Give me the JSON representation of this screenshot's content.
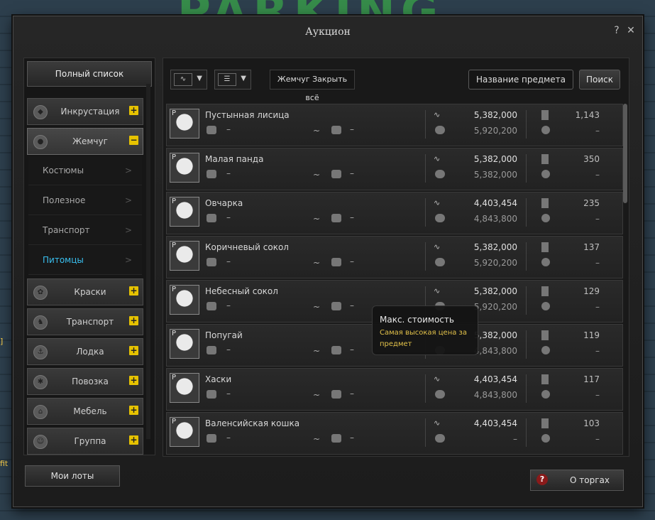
{
  "window": {
    "title": "Аукцион",
    "help": "?",
    "close": "✕"
  },
  "background": {
    "sign": "PARKING"
  },
  "side_texts": [
    "]",
    "fit"
  ],
  "sidebar": {
    "header": "Полный список",
    "categories": [
      {
        "label": "Инкрустация",
        "toggle": "+",
        "icon": "gem-icon"
      },
      {
        "label": "Жемчуг",
        "toggle": "−",
        "icon": "pearl-icon",
        "active": true
      },
      {
        "label": "Краски",
        "toggle": "+",
        "icon": "palette-icon"
      },
      {
        "label": "Транспорт",
        "toggle": "+",
        "icon": "horse-icon"
      },
      {
        "label": "Лодка",
        "toggle": "+",
        "icon": "anchor-icon"
      },
      {
        "label": "Повозка",
        "toggle": "+",
        "icon": "wheel-icon"
      },
      {
        "label": "Мебель",
        "toggle": "+",
        "icon": "house-icon"
      },
      {
        "label": "Группа",
        "toggle": "+",
        "icon": "group-icon"
      }
    ],
    "subitems": [
      {
        "label": "Костюмы",
        "chev": ">"
      },
      {
        "label": "Полезное",
        "chev": ">"
      },
      {
        "label": "Транспорт",
        "chev": ">"
      },
      {
        "label": "Питомцы",
        "chev": ">",
        "active": true
      }
    ]
  },
  "footer": {
    "my_lots": "Мои лоты",
    "trade_help": "?",
    "trade": "О торгах"
  },
  "toolbar": {
    "filter": "Жемчуг Закрыть всё",
    "name_placeholder": "Название предмета",
    "search": "Поиск",
    "dropdown1_icon": "trend-icon",
    "dropdown2_icon": "list-icon"
  },
  "items": [
    {
      "name": "Пустынная лисица",
      "min": "–",
      "max": "–",
      "price": "5,382,000",
      "max_price": "5,920,200",
      "count": "1,143",
      "count2": "–"
    },
    {
      "name": "Малая панда",
      "min": "–",
      "max": "–",
      "price": "5,382,000",
      "max_price": "5,382,000",
      "count": "350",
      "count2": "–"
    },
    {
      "name": "Овчарка",
      "min": "–",
      "max": "–",
      "price": "4,403,454",
      "max_price": "4,843,800",
      "count": "235",
      "count2": "–"
    },
    {
      "name": "Коричневый сокол",
      "min": "–",
      "max": "–",
      "price": "5,382,000",
      "max_price": "5,920,200",
      "count": "137",
      "count2": "–"
    },
    {
      "name": "Небесный сокол",
      "min": "–",
      "max": "–",
      "price": "5,382,000",
      "max_price": "5,920,200",
      "count": "129",
      "count2": "–"
    },
    {
      "name": "Попугай",
      "min": "–",
      "max": "–",
      "price": "5,382,000",
      "max_price": "4,843,800",
      "count": "119",
      "count2": "–"
    },
    {
      "name": "Хаски",
      "min": "–",
      "max": "–",
      "price": "4,403,454",
      "max_price": "4,843,800",
      "count": "117",
      "count2": "–"
    },
    {
      "name": "Валенсийская кошка",
      "min": "–",
      "max": "–",
      "price": "4,403,454",
      "max_price": "–",
      "count": "103",
      "count2": "–"
    }
  ],
  "common": {
    "tilde": "~",
    "pm": "P"
  },
  "tooltip": {
    "title": "Макс. стоимость",
    "desc": "Самая высокая цена за предмет"
  }
}
